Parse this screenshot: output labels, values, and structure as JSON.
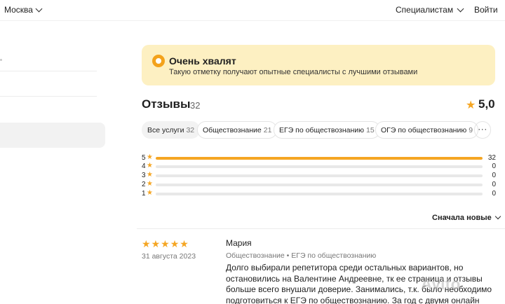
{
  "topbar": {
    "city": "Москва",
    "specialists": "Специалистам",
    "login": "Войти"
  },
  "highlight": {
    "title": "Очень хвалят",
    "subtitle": "Такую отметку получают опытные специалисты с лучшими отзывами",
    "accent_color": "#f3a21b",
    "background_color": "#fdf0c2"
  },
  "reviews": {
    "title": "Отзывы",
    "count": "32",
    "rating": "5,0",
    "star_color": "#f5a623"
  },
  "filters": [
    {
      "label": "Все услуги",
      "count": "32"
    },
    {
      "label": "Обществознание",
      "count": "21"
    },
    {
      "label": "ЕГЭ по обществознанию",
      "count": "15"
    },
    {
      "label": "ОГЭ по обществознанию",
      "count": "9"
    }
  ],
  "more_label": "···",
  "distribution": [
    {
      "stars": "5",
      "count": "32",
      "fraction": 1.0
    },
    {
      "stars": "4",
      "count": "0",
      "fraction": 0
    },
    {
      "stars": "3",
      "count": "0",
      "fraction": 0
    },
    {
      "stars": "2",
      "count": "0",
      "fraction": 0
    },
    {
      "stars": "1",
      "count": "0",
      "fraction": 0
    }
  ],
  "sort": {
    "label": "Сначала новые"
  },
  "review": {
    "rating_stars": 4.5,
    "date": "31 августа 2023",
    "author": "Мария",
    "service": "Обществознание • ЕГЭ по обществознанию",
    "text": "Долго выбирали репетитора среди остальных вариантов, но остановились на Валентине Андреевне, тк ее страница и отзывы больше всего внушали доверие. Занимались, т.к. было необходимо подготовиться к ЕГЭ по обществознанию. За год с двумя онлайн"
  },
  "watermark": "Avito"
}
